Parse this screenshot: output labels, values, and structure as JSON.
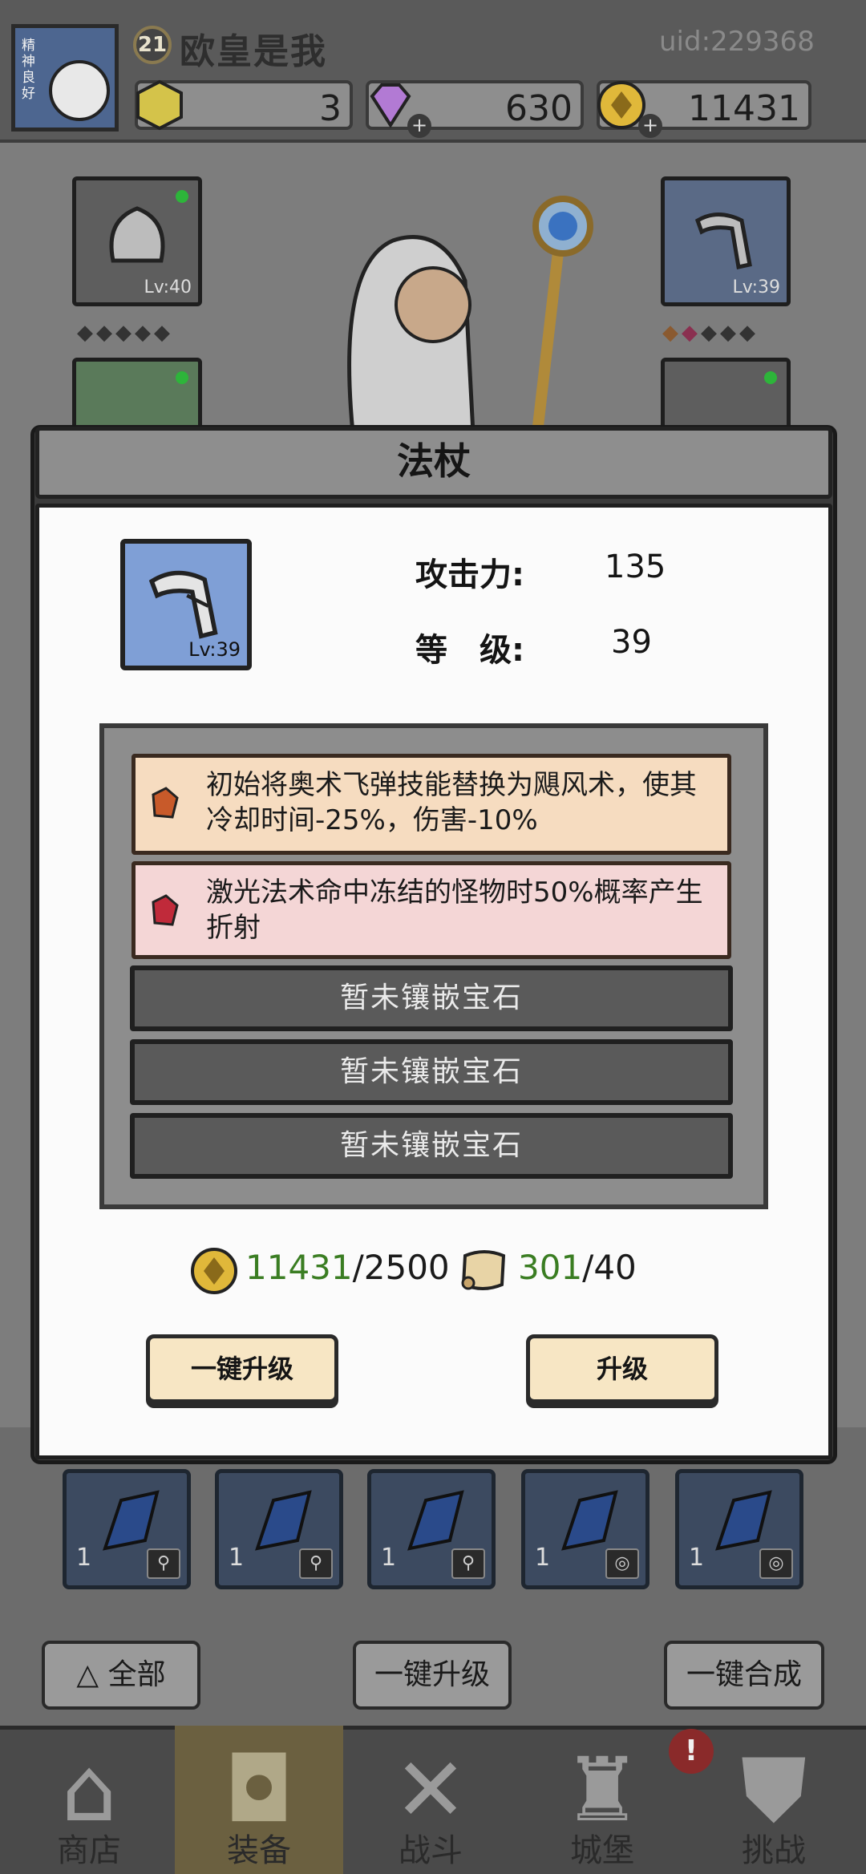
{
  "player": {
    "level": "21",
    "name": "欧皇是我",
    "uid": "uid:229368",
    "avatar_seal": "精神良好"
  },
  "resources": [
    {
      "icon": "hexagon-gem-icon",
      "value": "3",
      "color": "#d4c34a"
    },
    {
      "icon": "diamond-icon",
      "value": "630",
      "color": "#b27ad4"
    },
    {
      "icon": "gold-coin-icon",
      "value": "11431",
      "color": "#e0b83a"
    }
  ],
  "equipment_slots": {
    "left_top": {
      "icon": "hood-icon",
      "level": "Lv:40"
    },
    "right_top": {
      "icon": "staff-icon",
      "level": "Lv:39"
    }
  },
  "modal": {
    "title": "法杖",
    "item_icon": "staff-icon",
    "item_level": "Lv:39",
    "stats": [
      {
        "label": "攻击力:",
        "value": "135"
      },
      {
        "label": "等　级:",
        "value": "39"
      }
    ],
    "effects": [
      {
        "icon": "orange-gem-icon",
        "text": "初始将奥术飞弹技能替换为飓风术，使其冷却时间-25%，伤害-10%",
        "bg": "#f6dcc0",
        "gem_color": "#c85a2a"
      },
      {
        "icon": "red-gem-icon",
        "text": "激光法术命中冻结的怪物时50%概率产生折射",
        "bg": "#f4d6d6",
        "gem_color": "#c02a3a"
      }
    ],
    "empty_sockets": [
      "暂未镶嵌宝石",
      "暂未镶嵌宝石",
      "暂未镶嵌宝石"
    ],
    "costs": [
      {
        "icon": "gold-coin-icon",
        "have": "11431",
        "need": "/2500"
      },
      {
        "icon": "scroll-icon",
        "have": "301",
        "need": "/40"
      }
    ],
    "buttons": {
      "one_click_upgrade": "一键升级",
      "upgrade": "升级"
    }
  },
  "inventory_counts": [
    "1",
    "1",
    "1",
    "1",
    "1"
  ],
  "bottom_actions": {
    "filter": "全部",
    "one_click_upgrade": "一键升级",
    "one_click_merge": "一键合成"
  },
  "nav": [
    {
      "icon": "shop-icon",
      "label": "商店"
    },
    {
      "icon": "bag-icon",
      "label": "装备"
    },
    {
      "icon": "crossed-swords-icon",
      "label": "战斗"
    },
    {
      "icon": "castle-icon",
      "label": "城堡"
    },
    {
      "icon": "shield-icon",
      "label": "挑战"
    }
  ],
  "nav_badge": "!"
}
